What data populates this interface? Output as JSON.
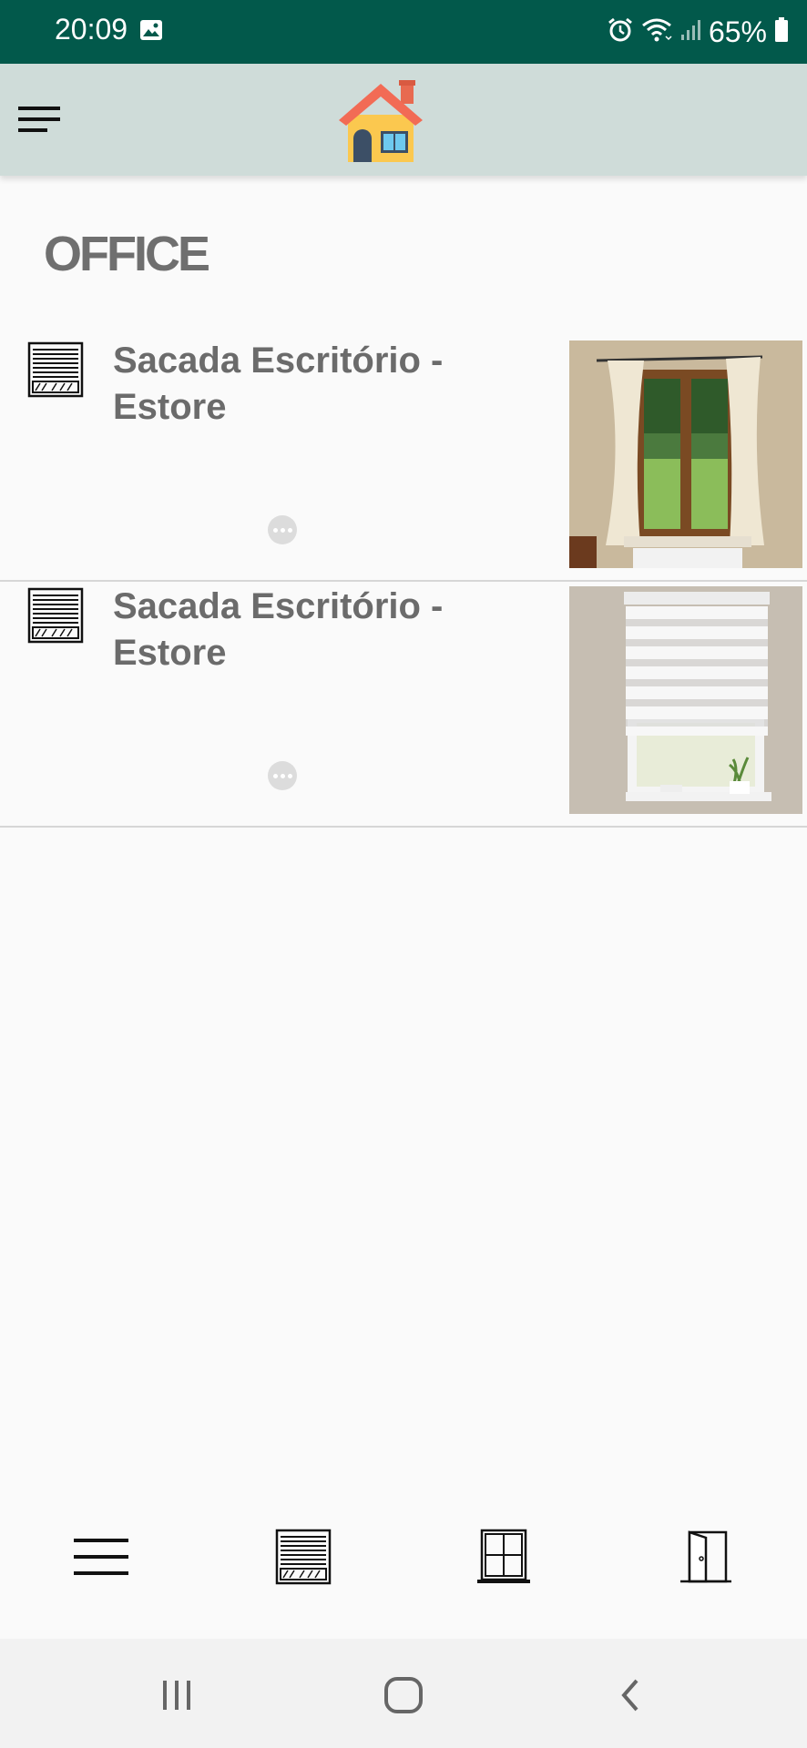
{
  "status_bar": {
    "time": "20:09",
    "battery_percent": "65%",
    "icons": [
      "image-icon",
      "alarm-icon",
      "wifi-icon",
      "signal-icon",
      "battery-icon"
    ]
  },
  "app_bar": {
    "menu_icon": "hamburger-menu-icon",
    "logo_icon": "house-icon"
  },
  "section": {
    "title": "OFFICE"
  },
  "devices": [
    {
      "name": "Sacada Escritório - Estore",
      "icon": "blinds-icon",
      "photo": "window-with-curtains"
    },
    {
      "name": "Sacada Escritório - Estore",
      "icon": "blinds-icon",
      "photo": "window-with-zebra-blind"
    }
  ],
  "bottom_nav": [
    "menu-icon",
    "blinds-icon",
    "window-icon",
    "door-icon"
  ],
  "system_nav": [
    "recent-apps-icon",
    "home-icon",
    "back-icon"
  ],
  "colors": {
    "status_bar": "#02594b",
    "app_bar": "#cfdcd9",
    "background": "#fafafa",
    "text_gray": "#6b6b6b"
  }
}
